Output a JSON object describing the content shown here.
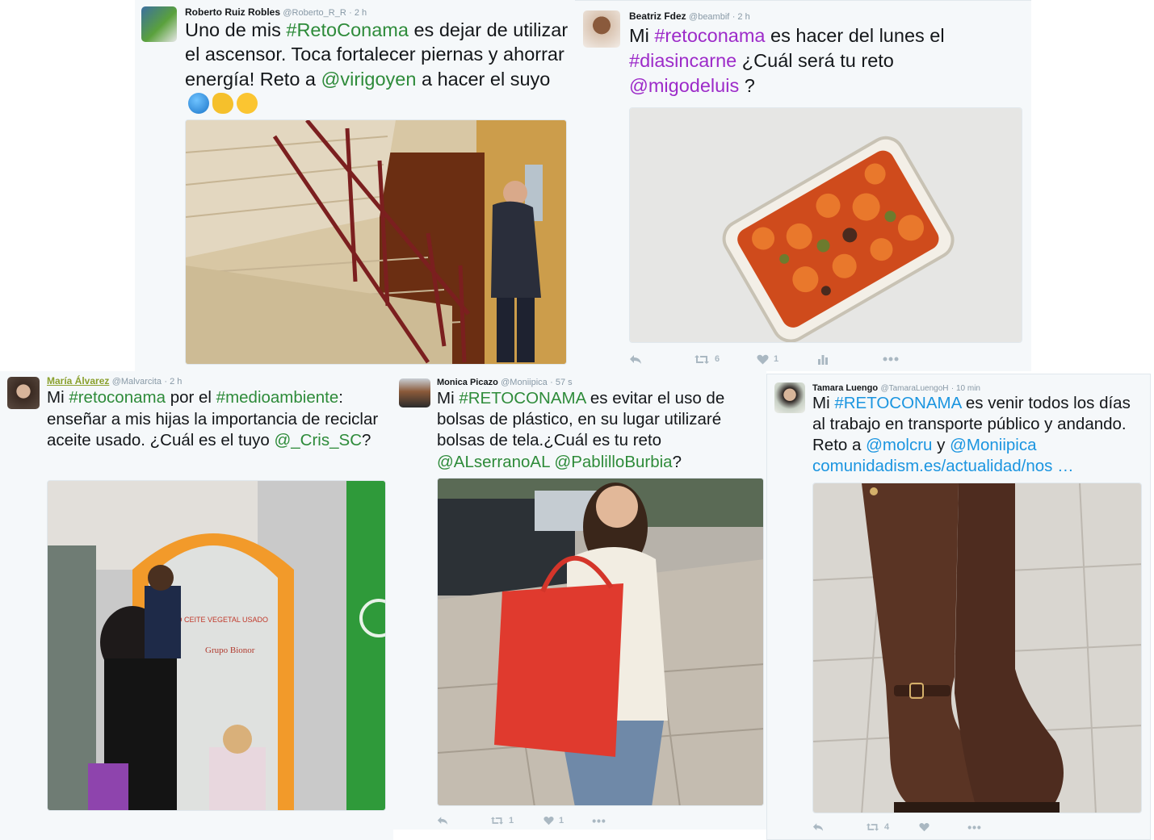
{
  "colors": {
    "hashtag_green": "#2e8b3a",
    "hashtag_purple": "#9d2bc9",
    "hashtag_blue": "#1b95e0",
    "link_olive": "#8aa02d",
    "action_gray": "#aab8c2"
  },
  "tweets": [
    {
      "name": "Roberto Ruiz Robles",
      "handle": "@Roberto_R_R",
      "time": "· 2 h",
      "text": [
        {
          "t": "Uno de mis "
        },
        {
          "t": "#RetoConama",
          "link": true
        },
        {
          "t": " es dejar de utilizar el ascensor. Toca fortalecer piernas y ahorrar energía! Reto a "
        },
        {
          "t": "@virigoyen",
          "link": true
        },
        {
          "t": " a hacer el suyo "
        }
      ],
      "emojis": [
        "globe-emoji",
        "flexed-biceps-emoji",
        "winking-face-emoji"
      ]
    },
    {
      "name": "Beatriz Fdez",
      "handle": "@beambif",
      "time": "· 2 h",
      "text": [
        {
          "t": "Mi "
        },
        {
          "t": "#retoconama",
          "link": true
        },
        {
          "t": " es hacer del lunes el "
        },
        {
          "t": "#diasincarne",
          "link": true
        },
        {
          "t": "  ¿Cuál será tu reto "
        },
        {
          "t": "@migodeluis",
          "link": true
        },
        {
          "t": " ?"
        }
      ],
      "retweets": "6",
      "likes": "1"
    },
    {
      "name": "María Álvarez",
      "handle": "@Malvarcita",
      "time": "· 2 h",
      "text": [
        {
          "t": "Mi "
        },
        {
          "t": "#retoconama",
          "link": true
        },
        {
          "t": " por el "
        },
        {
          "t": "#medioambiente",
          "link": true
        },
        {
          "t": ": enseñar a mis hijas la importancia de reciclar aceite usado. ¿Cuál es el tuyo "
        },
        {
          "t": "@_Cris_SC",
          "link": true
        },
        {
          "t": "?"
        }
      ],
      "container_sign": "D  CEITE VEGETAL USADO",
      "container_brand": "Grupo Bionor"
    },
    {
      "name": "Monica Picazo",
      "handle": "@Moniipica",
      "time": "· 57 s",
      "text": [
        {
          "t": "Mi "
        },
        {
          "t": "#RETOCONAMA",
          "link": true
        },
        {
          "t": "  es evitar el uso de bolsas de plástico, en su lugar utilizaré bolsas de tela.¿Cuál es tu reto "
        },
        {
          "t": "@ALserranoAL",
          "link": true
        },
        {
          "t": "  "
        },
        {
          "t": "@PablilloBurbia",
          "link": true
        },
        {
          "t": "?"
        }
      ],
      "retweets": "1",
      "likes": "1"
    },
    {
      "name": "Tamara Luengo",
      "handle": "@TamaraLuengoH",
      "time": "· 10 min",
      "text": [
        {
          "t": "Mi "
        },
        {
          "t": "#RETOCONAMA",
          "link": true
        },
        {
          "t": " es venir todos los días al trabajo en transporte público y andando. Reto a "
        },
        {
          "t": "@molcru",
          "link": true
        },
        {
          "t": " y "
        },
        {
          "t": "@Moniipica",
          "link": true
        },
        {
          "t": " "
        },
        {
          "t": "comunidadism.es/actualidad/nos …",
          "link": true
        }
      ],
      "retweets": "4"
    }
  ]
}
